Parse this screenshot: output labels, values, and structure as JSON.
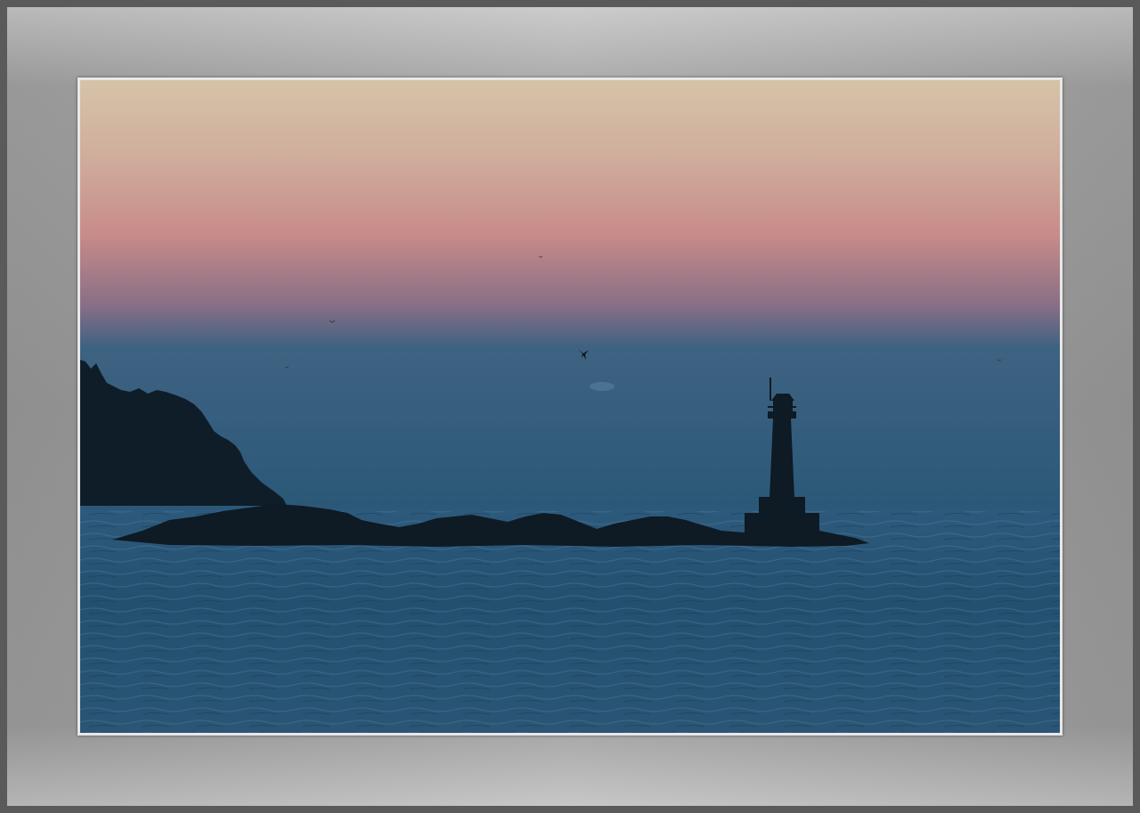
{
  "scene": {
    "subject": "lighthouse",
    "colors": {
      "sky_top": "#d2bba2",
      "sky_mid": "#c98a86",
      "sky_low": "#2f5b7c",
      "sea": "#224a6a",
      "silhouette": "#0e1a24",
      "frame": "#a0a0a0"
    }
  }
}
